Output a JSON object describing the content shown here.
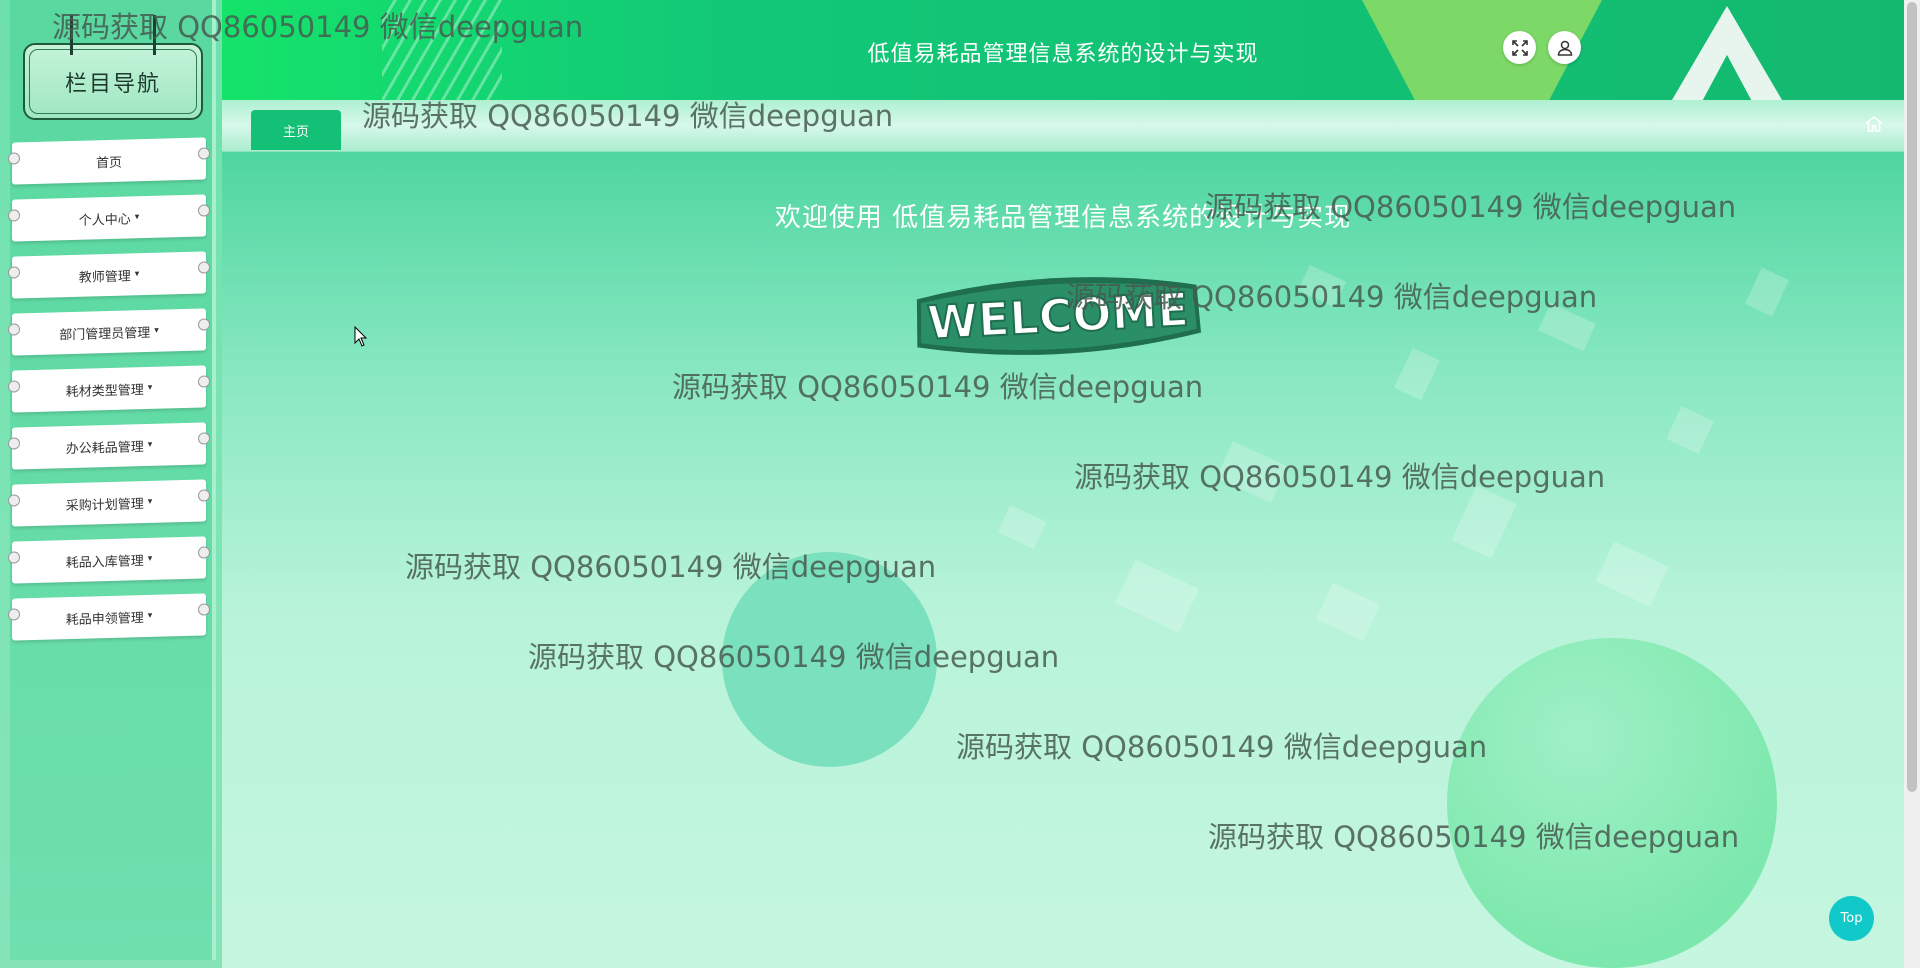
{
  "sidebar": {
    "brand": "栏目导航",
    "items": [
      {
        "label": "首页",
        "has_caret": false
      },
      {
        "label": "个人中心",
        "has_caret": true
      },
      {
        "label": "教师管理",
        "has_caret": true
      },
      {
        "label": "部门管理员管理",
        "has_caret": true
      },
      {
        "label": "耗材类型管理",
        "has_caret": true
      },
      {
        "label": "办公耗品管理",
        "has_caret": true
      },
      {
        "label": "采购计划管理",
        "has_caret": true
      },
      {
        "label": "耗品入库管理",
        "has_caret": true
      },
      {
        "label": "耗品申领管理",
        "has_caret": true
      }
    ],
    "caret": "▾"
  },
  "header": {
    "title": "低值易耗品管理信息系统的设计与实现",
    "buttons": [
      "fullscreen-icon",
      "user-icon"
    ]
  },
  "tabs": {
    "items": [
      {
        "label": "主页"
      }
    ],
    "home_icon": "home-icon"
  },
  "main": {
    "welcome": "欢迎使用 低值易耗品管理信息系统的设计与实现",
    "logo_text": "WELCOME",
    "top_button": "Top"
  },
  "watermark": "源码获取 QQ86050149 微信deepguan",
  "colors": {
    "header_green": "#13b96f",
    "tab_active": "#13c075",
    "top_button": "#12c9c9"
  }
}
